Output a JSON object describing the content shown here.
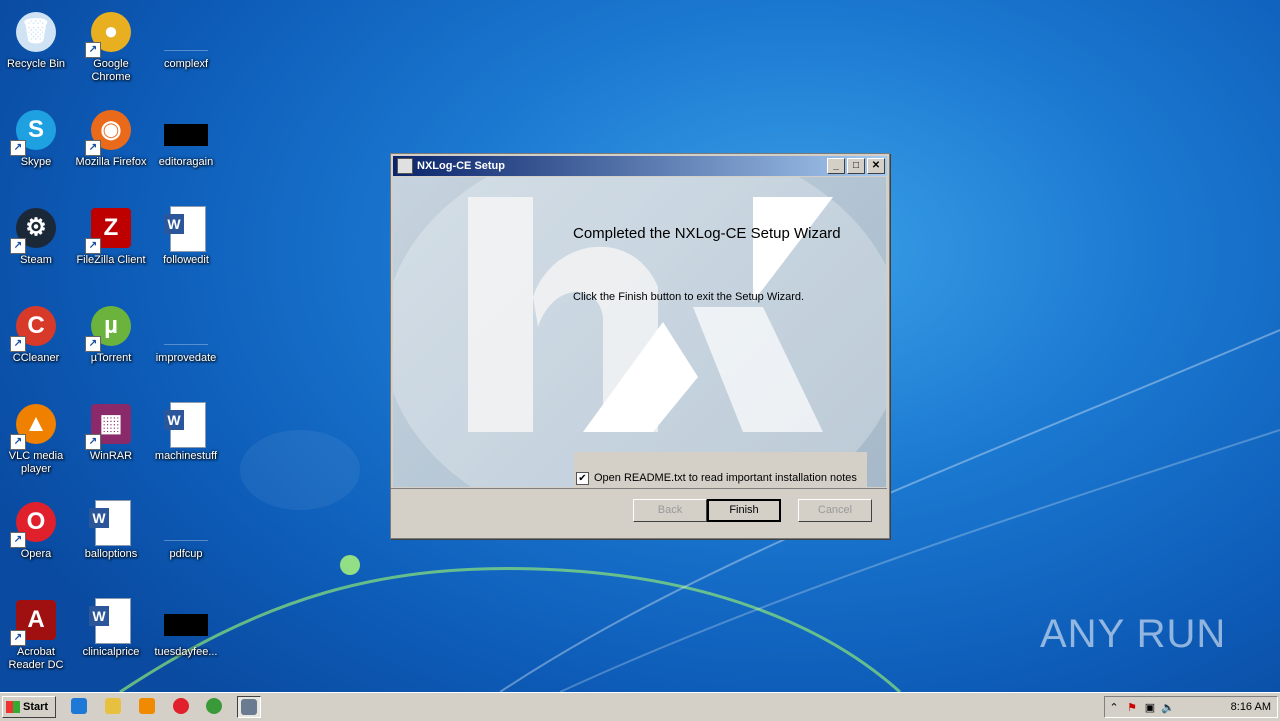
{
  "desktop_icons": [
    {
      "label": "Recycle Bin",
      "icon": "recycle-bin-icon",
      "shortcut": false
    },
    {
      "label": "Google Chrome",
      "icon": "chrome-icon",
      "shortcut": true
    },
    {
      "label": "complexf",
      "icon": "blank-file-icon",
      "shortcut": false
    },
    {
      "label": "Skype",
      "icon": "skype-icon",
      "shortcut": true
    },
    {
      "label": "Mozilla Firefox",
      "icon": "firefox-icon",
      "shortcut": true
    },
    {
      "label": "editoragain",
      "icon": "black-file-icon",
      "shortcut": false
    },
    {
      "label": "Steam",
      "icon": "steam-icon",
      "shortcut": true
    },
    {
      "label": "FileZilla Client",
      "icon": "filezilla-icon",
      "shortcut": true
    },
    {
      "label": "followedit",
      "icon": "word-doc-icon",
      "shortcut": false
    },
    {
      "label": "CCleaner",
      "icon": "ccleaner-icon",
      "shortcut": true
    },
    {
      "label": "µTorrent",
      "icon": "utorrent-icon",
      "shortcut": true
    },
    {
      "label": "improvedate",
      "icon": "blank-file-icon",
      "shortcut": false
    },
    {
      "label": "VLC media player",
      "icon": "vlc-icon",
      "shortcut": true
    },
    {
      "label": "WinRAR",
      "icon": "winrar-icon",
      "shortcut": true
    },
    {
      "label": "machinestuff",
      "icon": "word-doc-icon",
      "shortcut": false
    },
    {
      "label": "Opera",
      "icon": "opera-icon",
      "shortcut": true
    },
    {
      "label": "balloptions",
      "icon": "word-doc-icon",
      "shortcut": false
    },
    {
      "label": "pdfcup",
      "icon": "blank-file-icon",
      "shortcut": false
    },
    {
      "label": "Acrobat Reader DC",
      "icon": "acrobat-icon",
      "shortcut": true
    },
    {
      "label": "clinicalprice",
      "icon": "word-doc-icon",
      "shortcut": false
    },
    {
      "label": "tuesdayfee...",
      "icon": "black-file-icon",
      "shortcut": false
    }
  ],
  "dialog": {
    "title": "NXLog-CE Setup",
    "heading": "Completed the NXLog-CE Setup Wizard",
    "subtext": "Click the Finish button to exit the Setup Wizard.",
    "checkbox_label": "Open README.txt to read important installation notes",
    "checkbox_checked": true,
    "buttons": {
      "back": "Back",
      "finish": "Finish",
      "cancel": "Cancel"
    },
    "titlebar_buttons": {
      "minimize": "_",
      "maximize": "□",
      "close": "✕"
    }
  },
  "watermark": "ANY RUN",
  "taskbar": {
    "start_label": "Start",
    "pinned": [
      "ie-icon",
      "explorer-icon",
      "media-player-icon",
      "opera-icon",
      "chrome-icon",
      "setup-icon"
    ],
    "clock": "8:16 AM"
  },
  "colors": {
    "titlebar_start": "#0a246a",
    "titlebar_end": "#a6caf0",
    "dialog_bg": "#d4d0c8"
  }
}
